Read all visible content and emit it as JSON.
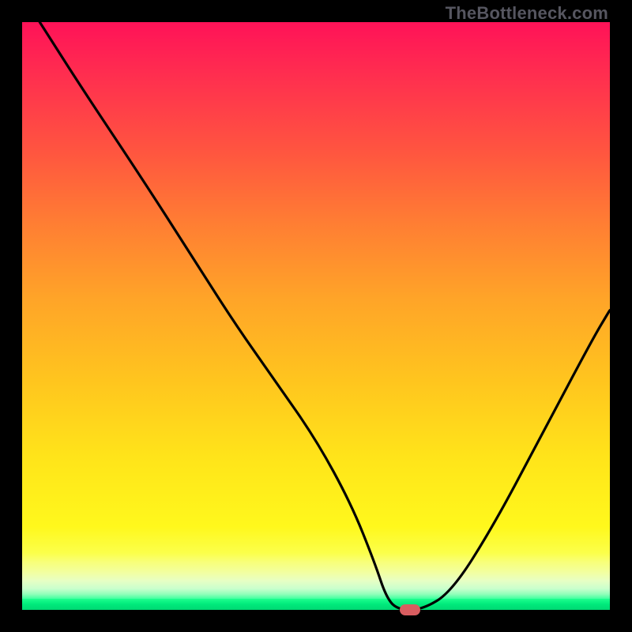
{
  "watermark": "TheBottleneck.com",
  "colors": {
    "frame": "#000000",
    "gradient_top": "#ff1258",
    "gradient_mid": "#ffe41a",
    "gradient_bottom": "#00d873",
    "curve": "#000000",
    "marker": "#d85d60"
  },
  "chart_data": {
    "type": "line",
    "title": "",
    "xlabel": "",
    "ylabel": "",
    "xlim": [
      0,
      100
    ],
    "ylim": [
      0,
      100
    ],
    "series": [
      {
        "name": "bottleneck-curve",
        "x": [
          3,
          10,
          20,
          29,
          36,
          43,
          50,
          56,
          60,
          62,
          64,
          68,
          73,
          80,
          88,
          97,
          100
        ],
        "y": [
          100,
          89,
          74,
          60,
          49,
          39,
          29,
          18,
          8,
          2,
          0,
          0,
          3,
          14,
          29,
          46,
          51
        ]
      }
    ],
    "marker": {
      "x": 66,
      "y": 0
    },
    "annotations": []
  }
}
